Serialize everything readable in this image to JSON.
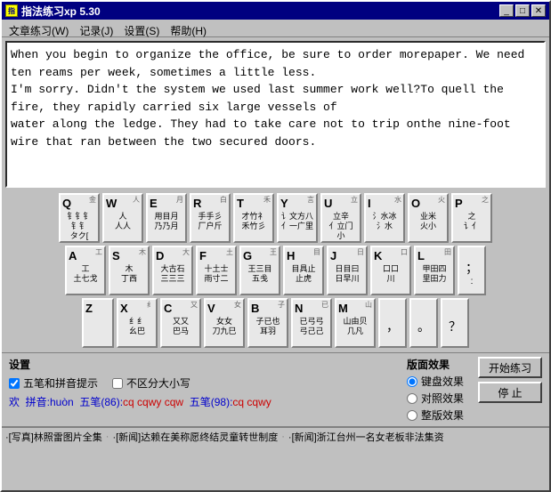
{
  "window": {
    "title": "指法练习xp 5.30",
    "icon": "⌨"
  },
  "menu": {
    "items": [
      {
        "label": "文章练习(W)",
        "id": "menu-article"
      },
      {
        "label": "记录(J)",
        "id": "menu-record"
      },
      {
        "label": "设置(S)",
        "id": "menu-settings"
      },
      {
        "label": "帮助(H)",
        "id": "menu-help"
      }
    ]
  },
  "text_content": "When you begin to organize the office, be sure to order morepaper. We need\nten reams per week, sometimes a little less.\nI'm sorry. Didn't the system we used last summer work well?To quell the\nfire, they rapidly carried six large vessels of\nwater along the ledge. They had to take care not to trip onthe nine-foot\nwire that ran between the two secured doors.",
  "keyboard": {
    "row1": [
      {
        "letter": "Q",
        "top_right": "金",
        "chinese": "钅钅钅\n钅钅钅\n タク["
      },
      {
        "letter": "W",
        "top_right": "人",
        "chinese": "人\n人人"
      },
      {
        "letter": "E",
        "top_right": "月",
        "chinese": "用目月\n乃乃月"
      },
      {
        "letter": "R",
        "top_right": "白",
        "chinese": "手手彡\n厂户斤"
      },
      {
        "letter": "T",
        "top_right": "禾",
        "chinese": "才竹礻\n イ竹彡"
      },
      {
        "letter": "Y",
        "top_right": "言",
        "chinese": "讠讠文方八\n イ一亻"
      },
      {
        "letter": "U",
        "top_right": "立",
        "chinese": "立辛\n亻亻立\n亻门"
      },
      {
        "letter": "I",
        "top_right": "水",
        "chinese": "氵氵冰水\n水"
      },
      {
        "letter": "O",
        "top_right": "火",
        "chinese": "业米\n火"
      },
      {
        "letter": "P",
        "top_right": "之",
        "chinese": "之\n亻 "
      }
    ],
    "row2": [
      {
        "letter": "A",
        "top_right": "工",
        "chinese": "工\n土七戈"
      },
      {
        "letter": "S",
        "top_right": "木",
        "chinese": "木\n丁西"
      },
      {
        "letter": "D",
        "top_right": "大",
        "chinese": "大古石\n三三三"
      },
      {
        "letter": "F",
        "top_right": "土",
        "chinese": "十土士\n雨寸二"
      },
      {
        "letter": "G",
        "top_right": "王",
        "chinese": "王\n三目\n五戋"
      },
      {
        "letter": "H",
        "top_right": "目",
        "chinese": "目\n具止虎\n止止"
      },
      {
        "letter": "J",
        "top_right": "日",
        "chinese": "日\n日目曰\n早川"
      },
      {
        "letter": "K",
        "top_right": "口",
        "chinese": "口口\n川"
      },
      {
        "letter": "L",
        "top_right": "田",
        "chinese": "甲\n田四里\n田力"
      },
      {
        "letter": "SEMI",
        "top_right": ";",
        "chinese": "；"
      }
    ],
    "row3": [
      {
        "letter": "Z",
        "top_right": "",
        "chinese": ""
      },
      {
        "letter": "X",
        "top_right": "纟",
        "chinese": "纟纟\n纟纟\n幺巴"
      },
      {
        "letter": "C",
        "top_right": "又",
        "chinese": "又又\n巴马"
      },
      {
        "letter": "V",
        "top_right": "女",
        "chinese": "女女\n刀九巳"
      },
      {
        "letter": "B",
        "top_right": "子",
        "chinese": "子\n已也\n耳羽"
      },
      {
        "letter": "N",
        "top_right": "已",
        "chinese": "已\n弓弓\n弓己己"
      },
      {
        "letter": "M",
        "top_right": "山",
        "chinese": "山\n由贝几\n几凡"
      }
    ]
  },
  "settings": {
    "label": "设置",
    "checkbox1_label": "五笔和拼音提示",
    "checkbox1_checked": true,
    "checkbox2_label": "不区分大小写",
    "checkbox2_checked": false,
    "effects_label": "版面效果",
    "radio_options": [
      {
        "label": "键盘效果",
        "checked": true
      },
      {
        "label": "对照效果",
        "checked": false
      },
      {
        "label": "整版效果",
        "checked": false
      }
    ],
    "btn_start": "开始练习",
    "btn_stop": "停 止"
  },
  "input_line": {
    "text": "欢  拼音:huòn  五笔(86):cq cqwy cqw  五笔(98):cq cqwy"
  },
  "statusbar": {
    "items": [
      "·[写真]林照雷图片全集",
      "·[新闻]达赖在美称愿终结灵童转世制度",
      "·[新闻]浙江台州一名女老板非法集资"
    ]
  }
}
